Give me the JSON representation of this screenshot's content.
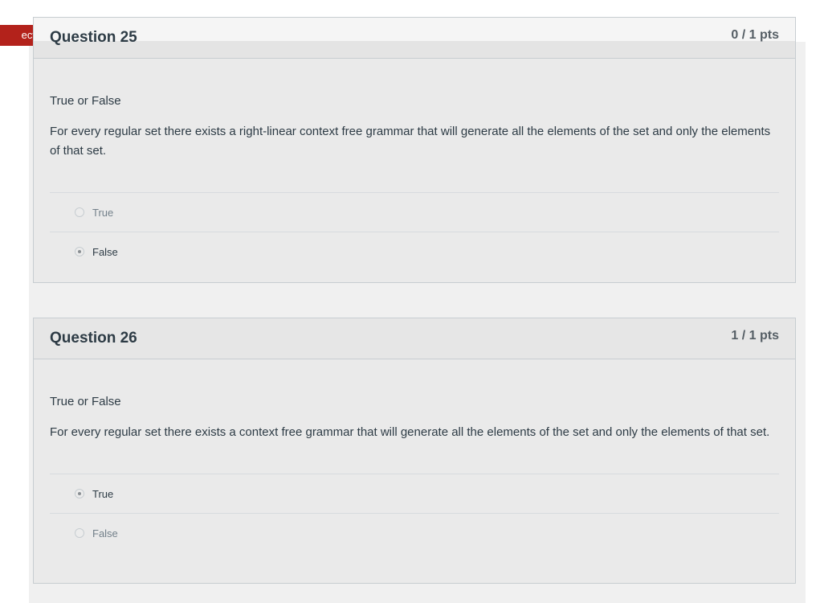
{
  "flag": {
    "label": "ect"
  },
  "questions": [
    {
      "title": "Question 25",
      "points": "0 / 1 pts",
      "type": "True or False",
      "text": "For every regular set there exists a right-linear context free grammar that will generate all the elements of the set and only the elements of that set.",
      "answers": [
        {
          "label": "True",
          "selected": false
        },
        {
          "label": "False",
          "selected": true
        }
      ]
    },
    {
      "title": "Question 26",
      "points": "1 / 1 pts",
      "type": "True or False",
      "text": "For every regular set there exists a context free grammar that will generate all the elements of the set and only the elements of that set.",
      "answers": [
        {
          "label": "True",
          "selected": true
        },
        {
          "label": "False",
          "selected": false
        }
      ]
    }
  ],
  "colors": {
    "flag": "#b3221b",
    "text": "#2d3b45",
    "panel": "#eaeaea",
    "border": "#c7cdd1"
  }
}
